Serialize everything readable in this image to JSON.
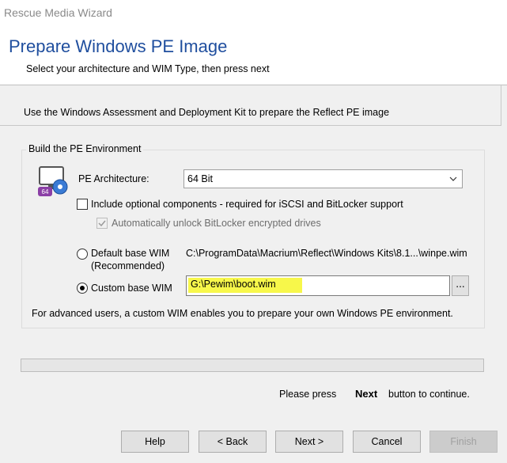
{
  "window": {
    "title": "Rescue Media Wizard"
  },
  "header": {
    "title": "Prepare Windows PE Image",
    "subtitle": "Select your architecture and WIM Type, then press next"
  },
  "info_line": "Use the Windows Assessment and Deployment Kit to prepare the Reflect PE image",
  "group": {
    "legend": "Build the PE Environment",
    "icon_badge": "64",
    "architecture_label": "PE Architecture:",
    "architecture_value": "64 Bit",
    "optional_components_label": "Include optional components - required for iSCSI and BitLocker support",
    "optional_components_checked": false,
    "bitlocker_label": "Automatically unlock BitLocker encrypted drives",
    "bitlocker_checked": true,
    "default_wim_label_line1": "Default base WIM",
    "default_wim_label_line2": "(Recommended)",
    "default_wim_path": "C:\\ProgramData\\Macrium\\Reflect\\Windows Kits\\8.1...\\winpe.wim",
    "custom_wim_label": "Custom base WIM",
    "custom_wim_value": "G:\\Pewim\\boot.wim",
    "selected_wim": "custom",
    "browse_label": "...",
    "footnote": "For advanced users, a custom WIM enables you to prepare your own Windows PE environment."
  },
  "progress": {
    "value": 0
  },
  "instruction": {
    "prefix": "Please press",
    "keyword": "Next",
    "suffix": "button to continue."
  },
  "buttons": {
    "help": "Help",
    "back": "< Back",
    "next": "Next >",
    "cancel": "Cancel",
    "finish": "Finish"
  },
  "colors": {
    "title_blue": "#1f4e9e",
    "highlight": "#f7f74a",
    "icon_purple": "#8b3fa6"
  }
}
